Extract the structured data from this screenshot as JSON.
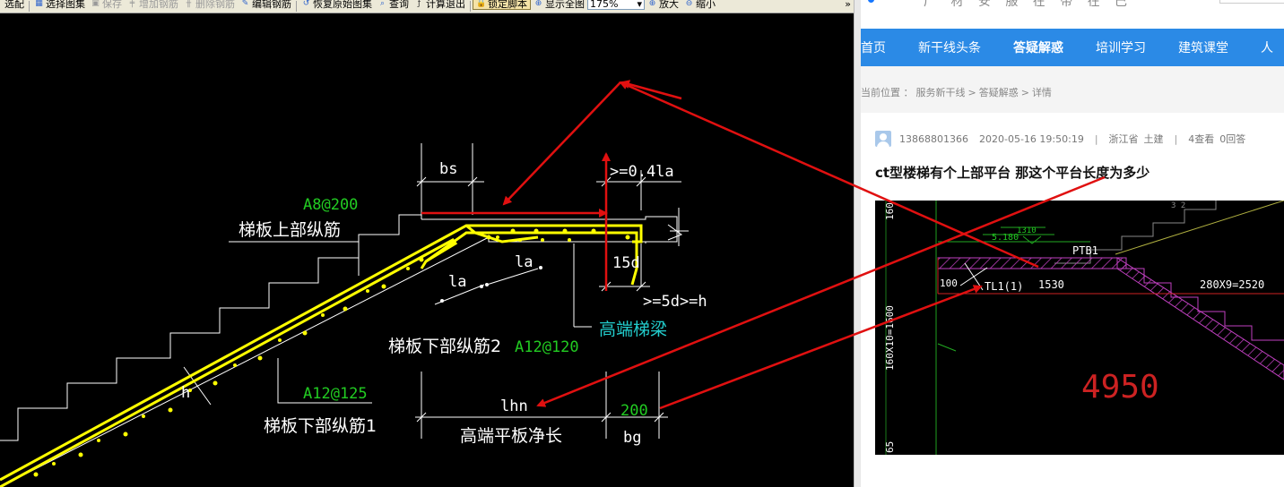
{
  "toolbar": {
    "items": [
      {
        "label": "选配",
        "icon": "match-icon",
        "disabled": false,
        "active": false
      },
      {
        "label": "选择图集",
        "icon": "select-atlas-icon",
        "disabled": false,
        "active": false
      },
      {
        "label": "保存",
        "icon": "save-icon",
        "disabled": true,
        "active": false
      },
      {
        "label": "增加钢筋",
        "icon": "add-rebar-icon",
        "disabled": true,
        "active": false
      },
      {
        "label": "删除钢筋",
        "icon": "delete-rebar-icon",
        "disabled": true,
        "active": false
      },
      {
        "label": "编辑钢筋",
        "icon": "edit-rebar-icon",
        "disabled": false,
        "active": false
      },
      {
        "label": "恢复原始图集",
        "icon": "restore-atlas-icon",
        "disabled": false,
        "active": false
      },
      {
        "label": "查询",
        "icon": "query-icon",
        "disabled": false,
        "active": false
      },
      {
        "label": "计算退出",
        "icon": "calc-exit-icon",
        "disabled": false,
        "active": false
      },
      {
        "label": "锁定脚本",
        "icon": "lock-script-icon",
        "disabled": false,
        "active": true
      },
      {
        "label": "显示全图",
        "icon": "show-all-icon",
        "disabled": false,
        "active": false
      }
    ],
    "zoom": "175%",
    "zoom_in": "放大",
    "zoom_out": "缩小",
    "overflow": "»"
  },
  "cad": {
    "labels": {
      "bs": "bs",
      "top_bar_spec": "A8@200",
      "top_bar_name": "梯板上部纵筋",
      "anchor_top": ">=0.4la",
      "la_1": "la",
      "la_2": "la",
      "d15": "15d",
      "d5h": ">=5d>=h",
      "high_beam": "高端梯梁",
      "bottom2_name": "梯板下部纵筋2",
      "bottom2_spec": "A12@120",
      "bottom1_spec": "A12@125",
      "bottom1_name": "梯板下部纵筋1",
      "h": "h",
      "lhn": "lhn",
      "bg_val": "200",
      "slab_len": "高端平板净长",
      "bg": "bg"
    }
  },
  "web": {
    "nav": [
      "首页",
      "新干线头条",
      "答疑解惑",
      "培训学习",
      "建筑课堂",
      "人"
    ],
    "nav_active": 2,
    "breadcrumb": [
      "当前位置 ：",
      "服务新干线",
      ">",
      "答疑解惑",
      ">",
      "详情"
    ],
    "meta": {
      "user": "13868801366",
      "time": "2020-05-16 19:50:19",
      "sep1": "|",
      "region": "浙江省",
      "category": "土建",
      "sep2": "|",
      "views": "4查看",
      "answers": "0回答"
    },
    "question_title": "ct型楼梯有个上部平台 那这个平台长度为多少",
    "drawing": {
      "t1310": "1310",
      "t5180": "5.180",
      "tPTB1": "PTB1",
      "t100": "100",
      "tTL1": "TL1(1)",
      "t1530": "1530",
      "t280": "280X9=2520",
      "t4950": "4950",
      "tv160": "160",
      "tv160x10": "160X10=1600",
      "tv65": "65",
      "t312": "3 2"
    }
  },
  "colors": {
    "cad_bg": "#000000",
    "rebar": "#ffff00",
    "cad_green": "#22cc22",
    "cad_cyan": "#22cccc",
    "annotation_red": "#e01010",
    "nav_blue": "#2b8ae6"
  }
}
